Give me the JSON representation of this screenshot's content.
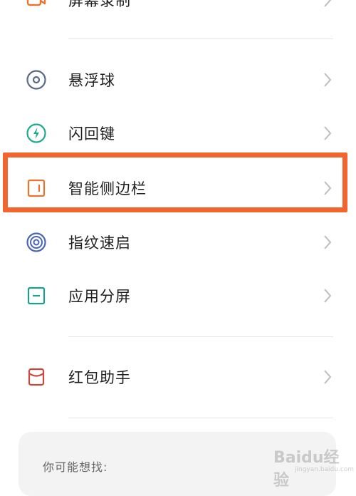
{
  "menu": {
    "items": [
      {
        "label": "屏幕录制",
        "icon": "screen-record-icon"
      },
      {
        "label": "悬浮球",
        "icon": "floating-ball-icon"
      },
      {
        "label": "闪回键",
        "icon": "flashback-key-icon"
      },
      {
        "label": "智能侧边栏",
        "icon": "smart-sidebar-icon"
      },
      {
        "label": "指纹速启",
        "icon": "fingerprint-quick-launch-icon"
      },
      {
        "label": "应用分屏",
        "icon": "split-screen-icon"
      },
      {
        "label": "红包助手",
        "icon": "red-envelope-icon"
      }
    ]
  },
  "suggest": {
    "title": "你可能想找:"
  },
  "watermark": {
    "text": "Baidu经验",
    "sub": "jingyan.baidu.com"
  },
  "colors": {
    "highlight": "#f2652f",
    "icon_gray": "#5a6a8a",
    "icon_green": "#1fa98e",
    "icon_orange": "#e8742f",
    "icon_blue": "#4a66b8",
    "icon_teal": "#1e9e8e",
    "icon_red": "#c8483c",
    "chevron": "#bdbdbd"
  }
}
